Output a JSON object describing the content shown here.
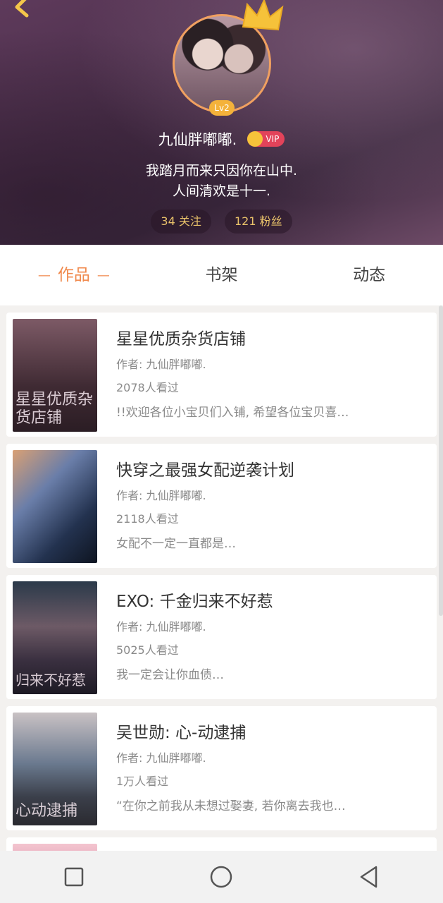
{
  "profile": {
    "level": "Lv2",
    "name": "九仙胖嘟嘟.",
    "vip_label": "VIP",
    "bio_line1": "我踏月而来只因你在山中.",
    "bio_line2": "人间清欢是十一.",
    "following": "34 关注",
    "followers": "121 粉丝"
  },
  "tabs": [
    {
      "label": "作品"
    },
    {
      "label": "书架"
    },
    {
      "label": "动态"
    }
  ],
  "works": [
    {
      "title": "星星优质杂货店铺",
      "author": "作者: 九仙胖嘟嘟.",
      "views": "2078人看过",
      "desc": "!!欢迎各位小宝贝们入铺, 希望各位宝贝喜…",
      "cover_text": "星星优质杂货店铺"
    },
    {
      "title": "快穿之最强女配逆袭计划",
      "author": "作者: 九仙胖嘟嘟.",
      "views": "2118人看过",
      "desc": "女配不一定一直都是…",
      "cover_text": ""
    },
    {
      "title": "EXO: 千金归来不好惹",
      "author": "作者: 九仙胖嘟嘟.",
      "views": "5025人看过",
      "desc": "我一定会让你血债…",
      "cover_text": "归来不好惹"
    },
    {
      "title": "吴世勋: 心-动逮捕",
      "author": "作者: 九仙胖嘟嘟.",
      "views": "1万人看过",
      "desc": "“在你之前我从未想过娶妻, 若你离去我也…",
      "cover_text": "心动逮捕"
    }
  ],
  "colors": {
    "accent": "#f0894c",
    "vip": "#e2435a",
    "level": "#f4b23a",
    "count_text": "#e9c26a"
  },
  "icons": {
    "back": "chevron-left-icon",
    "crown": "crown-icon",
    "nav_square": "square-icon",
    "nav_home": "circle-icon",
    "nav_back": "triangle-back-icon"
  }
}
